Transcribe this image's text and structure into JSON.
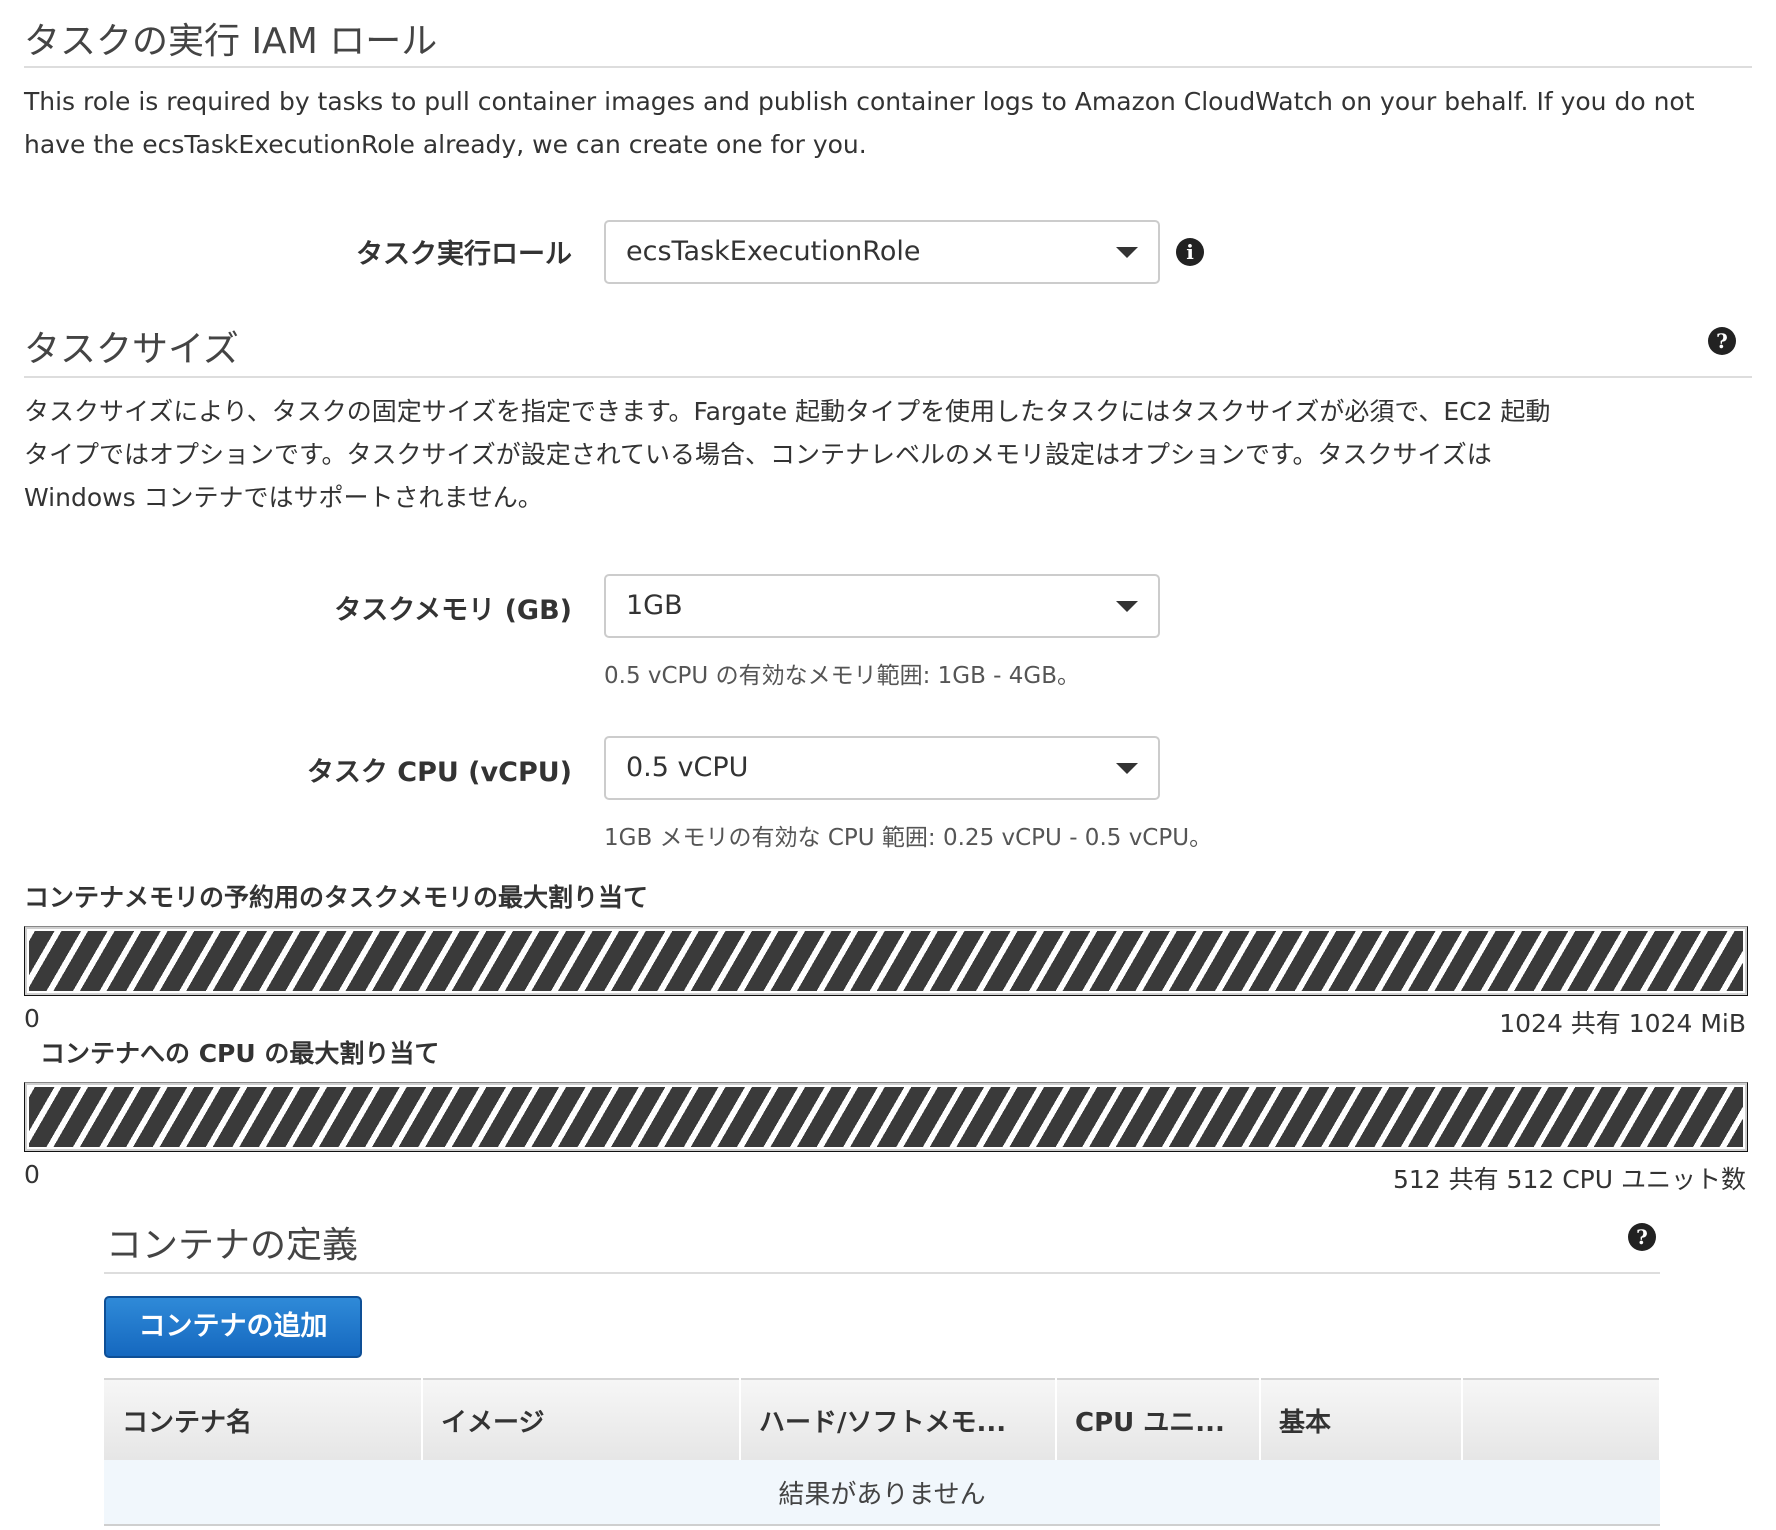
{
  "iam_section": {
    "title": "タスクの実行 IAM ロール",
    "description_line1": "This role is required by tasks to pull container images and publish container logs to Amazon CloudWatch on your behalf. If you do not",
    "description_line2": "have the ecsTaskExecutionRole already, we can create one for you.",
    "role_label": "タスク実行ロール",
    "role_value": "ecsTaskExecutionRole"
  },
  "size_section": {
    "title": "タスクサイズ",
    "description_line1": "タスクサイズにより、タスクの固定サイズを指定できます。Fargate 起動タイプを使用したタスクにはタスクサイズが必須で、EC2 起動",
    "description_line2": "タイプではオプションです。タスクサイズが設定されている場合、コンテナレベルのメモリ設定はオプションです。タスクサイズは",
    "description_line3": "Windows コンテナではサポートされません。",
    "memory_label": "タスクメモリ (GB)",
    "memory_value": "1GB",
    "memory_help": "0.5 vCPU の有効なメモリ範囲: 1GB - 4GB。",
    "cpu_label": "タスク CPU (vCPU)",
    "cpu_value": "0.5 vCPU",
    "cpu_help": "1GB メモリの有効な CPU 範囲: 0.25 vCPU - 0.5 vCPU。"
  },
  "memory_allocation": {
    "label": "コンテナメモリの予約用のタスクメモリの最大割り当て",
    "min": "0",
    "max_text": "1024 共有 1024 MiB",
    "shared_fraction": 1.0
  },
  "cpu_allocation": {
    "label": "コンテナへの CPU の最大割り当て",
    "min": "0",
    "max_text": "512 共有 512 CPU ユニット数",
    "shared_fraction": 1.0
  },
  "container_section": {
    "title": "コンテナの定義",
    "add_button": "コンテナの追加",
    "columns": [
      "コンテナ名",
      "イメージ",
      "ハード/ソフトメモ...",
      "CPU ユニ...",
      "基本",
      ""
    ],
    "empty_message": "結果がありません"
  },
  "icons": {
    "info": "info-icon",
    "help": "help-icon",
    "dropdown": "caret-down-icon"
  }
}
